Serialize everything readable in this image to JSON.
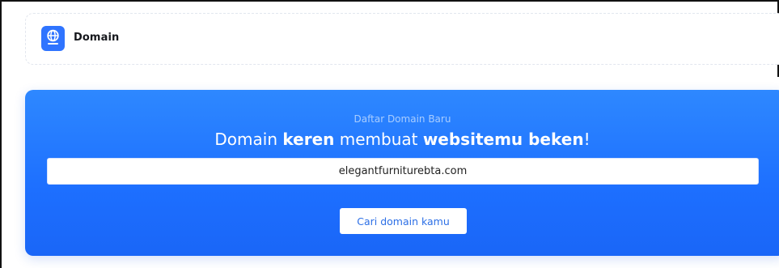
{
  "header": {
    "icon": "globe-icon",
    "title": "Domain"
  },
  "hero": {
    "subtitle": "Daftar Domain Baru",
    "headline": {
      "part1": "Domain ",
      "bold1": "keren",
      "part2": " membuat ",
      "bold2": "websitemu beken",
      "part3": "!"
    },
    "search": {
      "value": "elegantfurniturebta.com",
      "placeholder": ""
    },
    "button_label": "Cari domain kamu"
  },
  "colors": {
    "accent": "#2f74ff",
    "hero_top": "#2e88ff",
    "hero_bottom": "#1a66f7",
    "button_text": "#2c6fe6"
  }
}
